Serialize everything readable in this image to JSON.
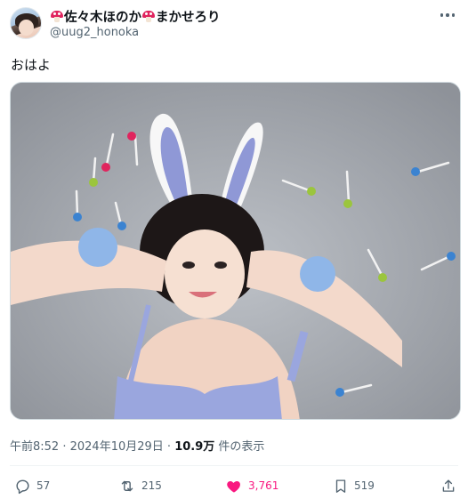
{
  "author": {
    "display_name": "佐々木ほのか",
    "display_name_suffix": "まかせろり",
    "handle": "@uug2_honoka",
    "name_emoji": "mushroom-icon"
  },
  "tweet": {
    "text": "おはよ",
    "time": "午前8:52",
    "separator": " · ",
    "date": "2024年10月29日",
    "views_count": "10.9万",
    "views_label": " 件の表示"
  },
  "actions": {
    "replies": "57",
    "retweets": "215",
    "likes": "3,761",
    "bookmarks": "519"
  },
  "colors": {
    "like_active": "#f91880",
    "muted_text": "#536471",
    "primary_text": "#0f1419"
  }
}
